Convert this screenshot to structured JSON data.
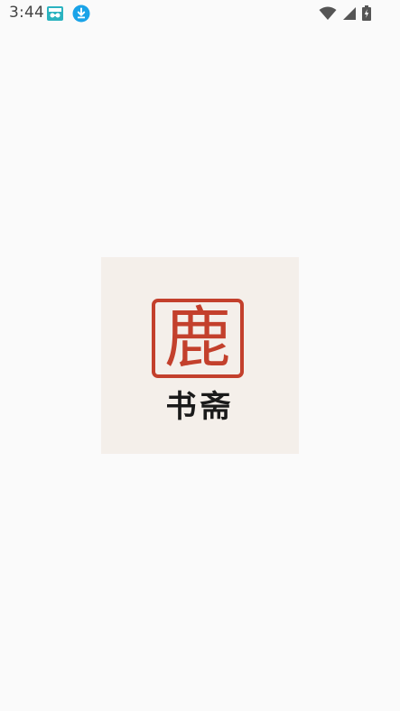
{
  "status_bar": {
    "time": "3:44",
    "notification_icons": [
      "vpn-app-icon",
      "download-icon"
    ],
    "system_icons": [
      "wifi-icon",
      "cellular-signal-icon",
      "battery-charging-icon"
    ]
  },
  "splash": {
    "logo_seal_char": "鹿",
    "brand_name": "书斋",
    "seal_color": "#c3402c",
    "card_background": "#f4efea"
  }
}
